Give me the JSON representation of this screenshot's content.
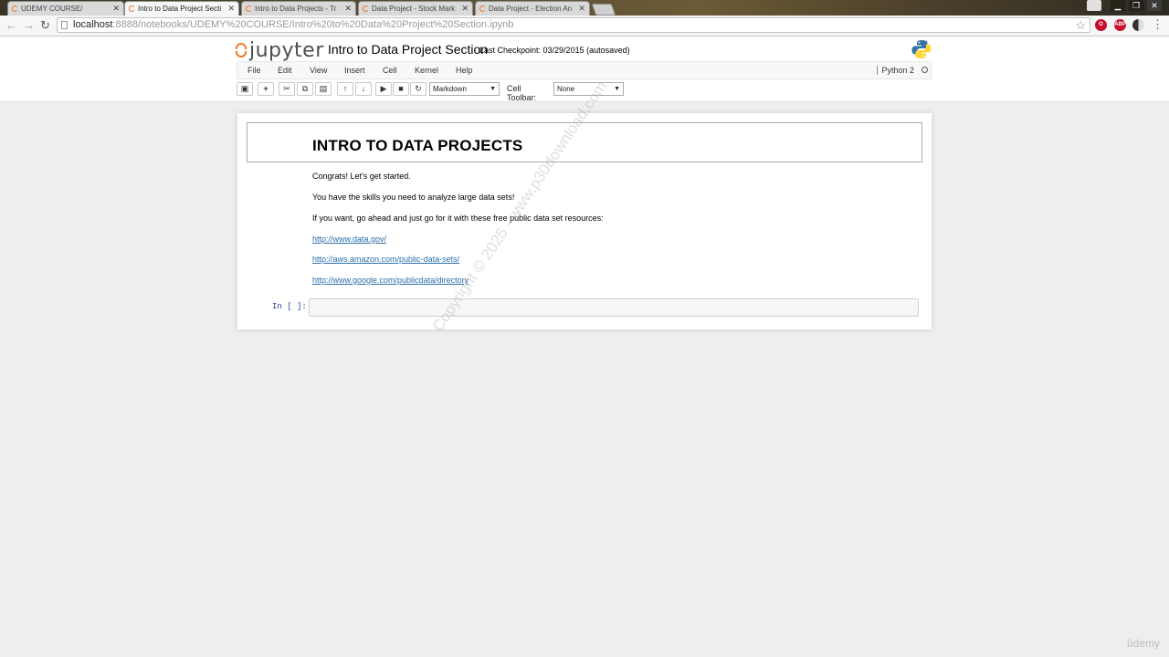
{
  "browser": {
    "tabs": [
      {
        "label": "UDEMY COURSE/",
        "active": false
      },
      {
        "label": "Intro to Data Project Secti",
        "active": true
      },
      {
        "label": "Intro to Data Projects - Tr",
        "active": false
      },
      {
        "label": "Data Project - Stock Mark",
        "active": false
      },
      {
        "label": "Data Project - Election An",
        "active": false
      }
    ],
    "url_host": "localhost",
    "url_rest": ":8888/notebooks/UDEMY%20COURSE/Intro%20to%20Data%20Project%20Section.ipynb",
    "ext_abp": "ABP"
  },
  "jupyter": {
    "logo_text": "jupyter",
    "notebook_title": "Intro to Data Project Section",
    "checkpoint": "Last Checkpoint: 03/29/2015 (autosaved)",
    "menu": [
      "File",
      "Edit",
      "View",
      "Insert",
      "Cell",
      "Kernel",
      "Help"
    ],
    "kernel": "Python 2",
    "toolbar": {
      "cell_type": "Markdown",
      "cell_toolbar_label": "Cell Toolbar:",
      "cell_toolbar_value": "None"
    }
  },
  "notebook": {
    "heading": "INTRO TO DATA PROJECTS",
    "paragraphs": [
      "Congrats! Let's get started.",
      "You have the skills you need to analyze large data sets!",
      "If you want, go ahead and just go for it with these free public data set resources:"
    ],
    "links": [
      "http://www.data.gov/",
      "http://aws.amazon.com/public-data-sets/",
      "http://www.google.com/publicdata/directory"
    ],
    "prompt": "In [ ]:"
  },
  "overlay": {
    "watermark": "Copyright © 2025 - www.p30download.com",
    "brand": "ûdemy"
  }
}
